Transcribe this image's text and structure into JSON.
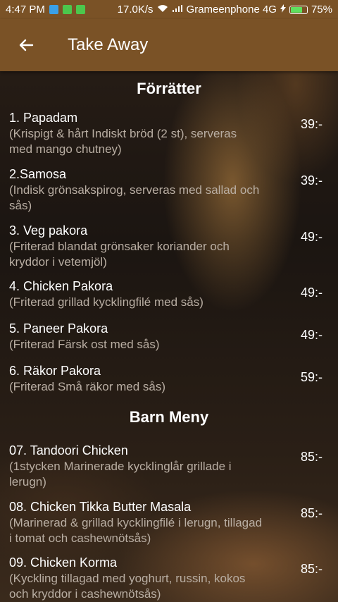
{
  "status": {
    "time": "4:47 PM",
    "network_speed": "17.0K/s",
    "carrier": "Grameenphone 4G",
    "battery": "75%",
    "battery_level": 0.75
  },
  "appbar": {
    "title": "Take Away"
  },
  "sections": [
    {
      "title": "Förrätter",
      "items": [
        {
          "name": "1. Papadam",
          "desc": "(Krispigt & hårt Indiskt bröd (2 st), serveras med mango chutney)",
          "price": "39:-"
        },
        {
          "name": "2.Samosa",
          "desc": "(Indisk grönsakspirog, serveras med sallad och sås)",
          "price": "39:-"
        },
        {
          "name": "3. Veg pakora",
          "desc": "(Friterad blandat grönsaker koriander och kryddor i vetemjöl)",
          "price": "49:-"
        },
        {
          "name": "4. Chicken Pakora",
          "desc": "(Friterad grillad kycklingfilé med sås)",
          "price": "49:-"
        },
        {
          "name": "5. Paneer Pakora",
          "desc": "(Friterad Färsk ost med sås)",
          "price": "49:-"
        },
        {
          "name": "6. Räkor Pakora",
          "desc": "(Friterad Små räkor med sås)",
          "price": "59:-"
        }
      ]
    },
    {
      "title": "Barn Meny",
      "items": [
        {
          "name": "07. Tandoori Chicken",
          "desc": "(1stycken Marinerade kycklinglår grillade i lerugn)",
          "price": "85:-"
        },
        {
          "name": "08. Chicken Tikka Butter Masala",
          "desc": "(Marinerad & grillad kycklingfilé i lerugn, tillagad i tomat och cashewnötsås)",
          "price": "85:-"
        },
        {
          "name": "09. Chicken Korma",
          "desc": "(Kyckling tillagad med yoghurt, russin, kokos och kryddor i cashewnötsås)",
          "price": "85:-"
        }
      ]
    }
  ]
}
